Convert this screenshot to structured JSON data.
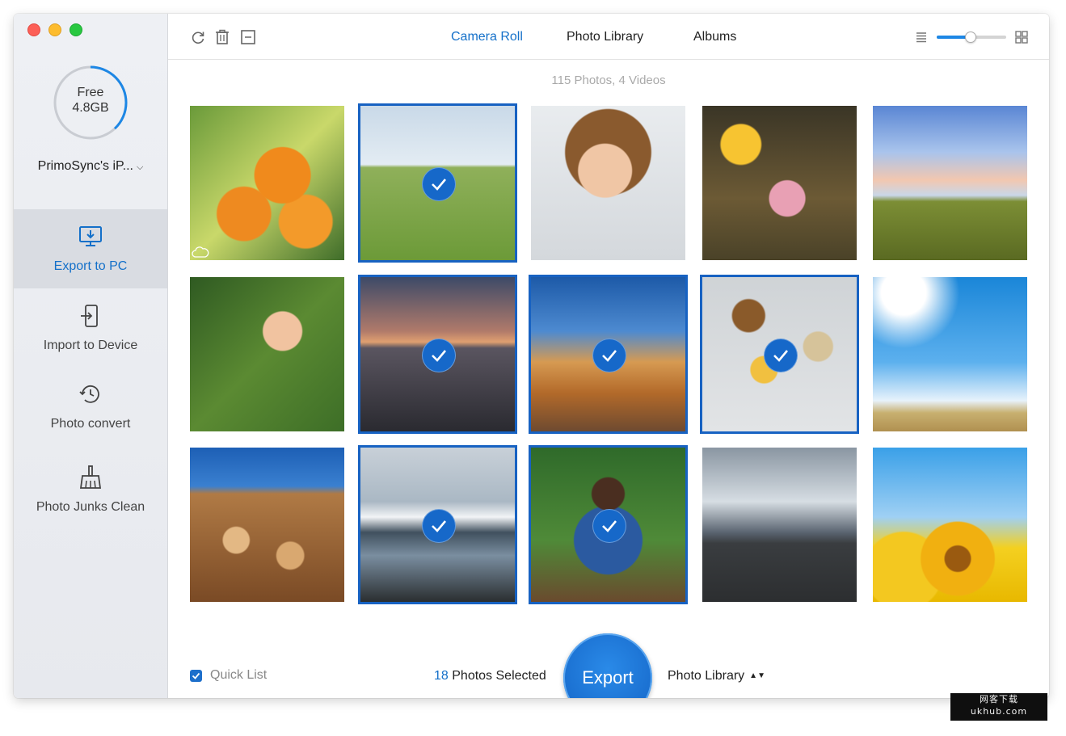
{
  "sidebar": {
    "storage": {
      "label": "Free",
      "value": "4.8GB",
      "used_fraction": 0.38
    },
    "device_name": "PrimoSync's iP...",
    "items": [
      {
        "label": "Export to PC",
        "icon": "monitor-download-icon",
        "active": true
      },
      {
        "label": "Import to Device",
        "icon": "import-device-icon",
        "active": false
      },
      {
        "label": "Photo convert",
        "icon": "history-clock-icon",
        "active": false
      },
      {
        "label": "Photo Junks Clean",
        "icon": "broom-icon",
        "active": false
      }
    ]
  },
  "toolbar": {
    "icons": [
      "refresh-icon",
      "trash-icon",
      "minus-box-icon"
    ],
    "tabs": [
      {
        "label": "Camera Roll",
        "active": true
      },
      {
        "label": "Photo Library",
        "active": false
      },
      {
        "label": "Albums",
        "active": false
      }
    ],
    "zoom_fraction": 0.48,
    "view_icons": [
      "list-view-icon",
      "grid-view-icon"
    ]
  },
  "content": {
    "count_text": "115 Photos, 4 Videos",
    "photos": [
      {
        "subject": "oranges on tree",
        "selected": false,
        "cloud": true
      },
      {
        "subject": "children running on grass",
        "selected": true
      },
      {
        "subject": "smiling girl with cup",
        "selected": false
      },
      {
        "subject": "girl with balloons",
        "selected": false
      },
      {
        "subject": "sky over field",
        "selected": false
      },
      {
        "subject": "woman leading by hand",
        "selected": false
      },
      {
        "subject": "beach pavilion at dusk",
        "selected": true
      },
      {
        "subject": "rocky canyon",
        "selected": true
      },
      {
        "subject": "grains and beans",
        "selected": true
      },
      {
        "subject": "blue sky with clouds",
        "selected": false
      },
      {
        "subject": "stacked logs",
        "selected": false
      },
      {
        "subject": "mountain lake",
        "selected": true
      },
      {
        "subject": "man with tablet on bench",
        "selected": true
      },
      {
        "subject": "road under cloudy sky",
        "selected": false
      },
      {
        "subject": "sunflowers",
        "selected": false
      }
    ]
  },
  "bottom": {
    "quick_list_label": "Quick List",
    "quick_list_checked": true,
    "selected_count": "18",
    "selected_suffix": " Photos Selected",
    "export_label": "Export",
    "target_label": "Photo Library"
  },
  "watermark": {
    "line1": "网客下载",
    "line2": "ukhub.com"
  },
  "colors": {
    "accent": "#1470c9",
    "selection_border": "#1762c2"
  }
}
